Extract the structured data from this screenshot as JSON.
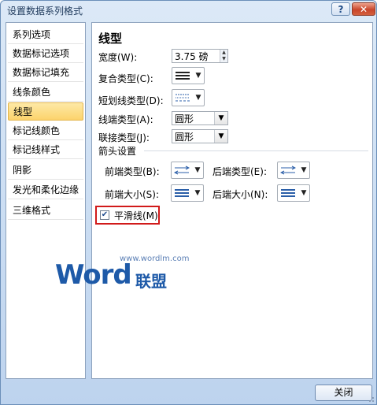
{
  "window": {
    "title": "设置数据系列格式"
  },
  "nav": {
    "items": [
      "系列选项",
      "数据标记选项",
      "数据标记填充",
      "线条颜色",
      "线型",
      "标记线颜色",
      "标记线样式",
      "阴影",
      "发光和柔化边缘",
      "三维格式"
    ],
    "selected_index": 4
  },
  "main": {
    "heading": "线型",
    "width_label": "宽度(W):",
    "width_value": "3.75 磅",
    "compound_label": "复合类型(C):",
    "dash_label": "短划线类型(D):",
    "cap_label": "线端类型(A):",
    "cap_value": "圆形",
    "join_label": "联接类型(J):",
    "join_value": "圆形",
    "arrow_section": "箭头设置",
    "begin_type_label": "前端类型(B):",
    "end_type_label": "后端类型(E):",
    "begin_size_label": "前端大小(S):",
    "end_size_label": "后端大小(N):",
    "smooth_label": "平滑线(M)",
    "smooth_checked": true
  },
  "watermark": {
    "url": "www.wordlm.com",
    "brand": "Word",
    "brand_cn": "联盟"
  },
  "footer": {
    "close_label": "关闭"
  },
  "colors": {
    "accent": "#1e5aa8",
    "selected_bg": "#fcd36c",
    "highlight_border": "#d11a1a"
  }
}
